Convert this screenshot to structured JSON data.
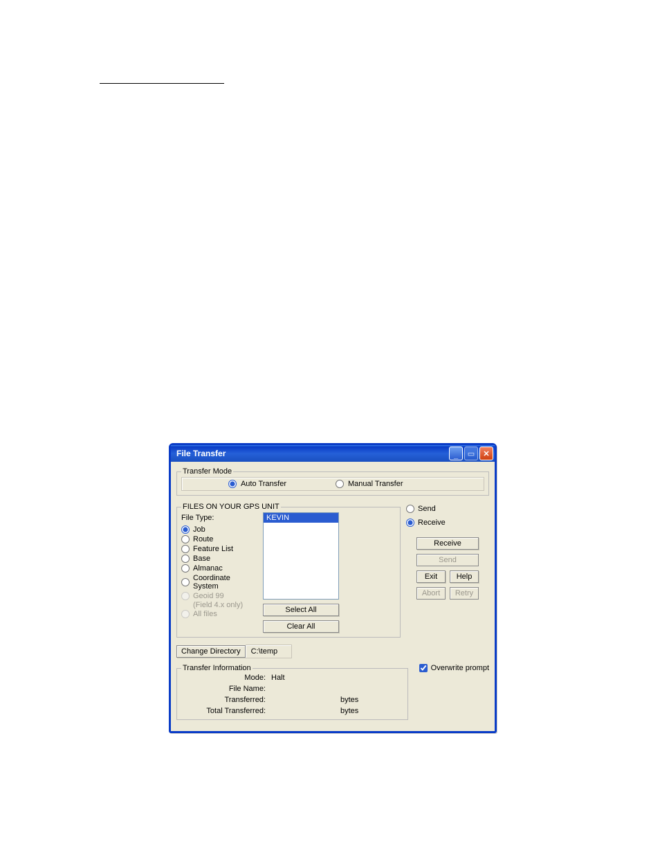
{
  "window": {
    "title": "File Transfer"
  },
  "transferMode": {
    "legend": "Transfer Mode",
    "auto": {
      "label": "Auto Transfer",
      "checked": true
    },
    "manual": {
      "label": "Manual Transfer",
      "checked": false
    }
  },
  "filesGroup": {
    "legend": "FILES ON YOUR GPS UNIT",
    "fileTypeLabel": "File Type:",
    "types": {
      "job": {
        "label": "Job",
        "checked": true,
        "disabled": false
      },
      "route": {
        "label": "Route",
        "checked": false,
        "disabled": false
      },
      "feat": {
        "label": "Feature List",
        "checked": false,
        "disabled": false
      },
      "base": {
        "label": "Base",
        "checked": false,
        "disabled": false
      },
      "alm": {
        "label": "Almanac",
        "checked": false,
        "disabled": false
      },
      "coord": {
        "label": "Coordinate System",
        "checked": false,
        "disabled": false
      },
      "geoid": {
        "label": "Geoid 99",
        "sub": "(Field 4.x only)",
        "checked": false,
        "disabled": true
      },
      "all": {
        "label": "All files",
        "checked": false,
        "disabled": true
      }
    },
    "listItems": [
      "KEVIN"
    ],
    "selectAll": "Select All",
    "clearAll": "Clear All"
  },
  "direction": {
    "send": {
      "label": "Send",
      "checked": false
    },
    "receive": {
      "label": "Receive",
      "checked": true
    }
  },
  "buttons": {
    "receive": "Receive",
    "send": "Send",
    "exit": "Exit",
    "help": "Help",
    "abort": "Abort",
    "retry": "Retry",
    "changeDir": "Change Directory"
  },
  "directory": {
    "path": "C:\\temp"
  },
  "transferInfo": {
    "legend": "Transfer Information",
    "modeLabel": "Mode:",
    "modeValue": "Halt",
    "fileNameLabel": "File Name:",
    "fileNameValue": "",
    "transferredLabel": "Transferred:",
    "transferredValue": "",
    "transferredUnit": "bytes",
    "totalLabel": "Total Transferred:",
    "totalValue": "",
    "totalUnit": "bytes"
  },
  "overwrite": {
    "label": "Overwrite prompt",
    "checked": true
  }
}
